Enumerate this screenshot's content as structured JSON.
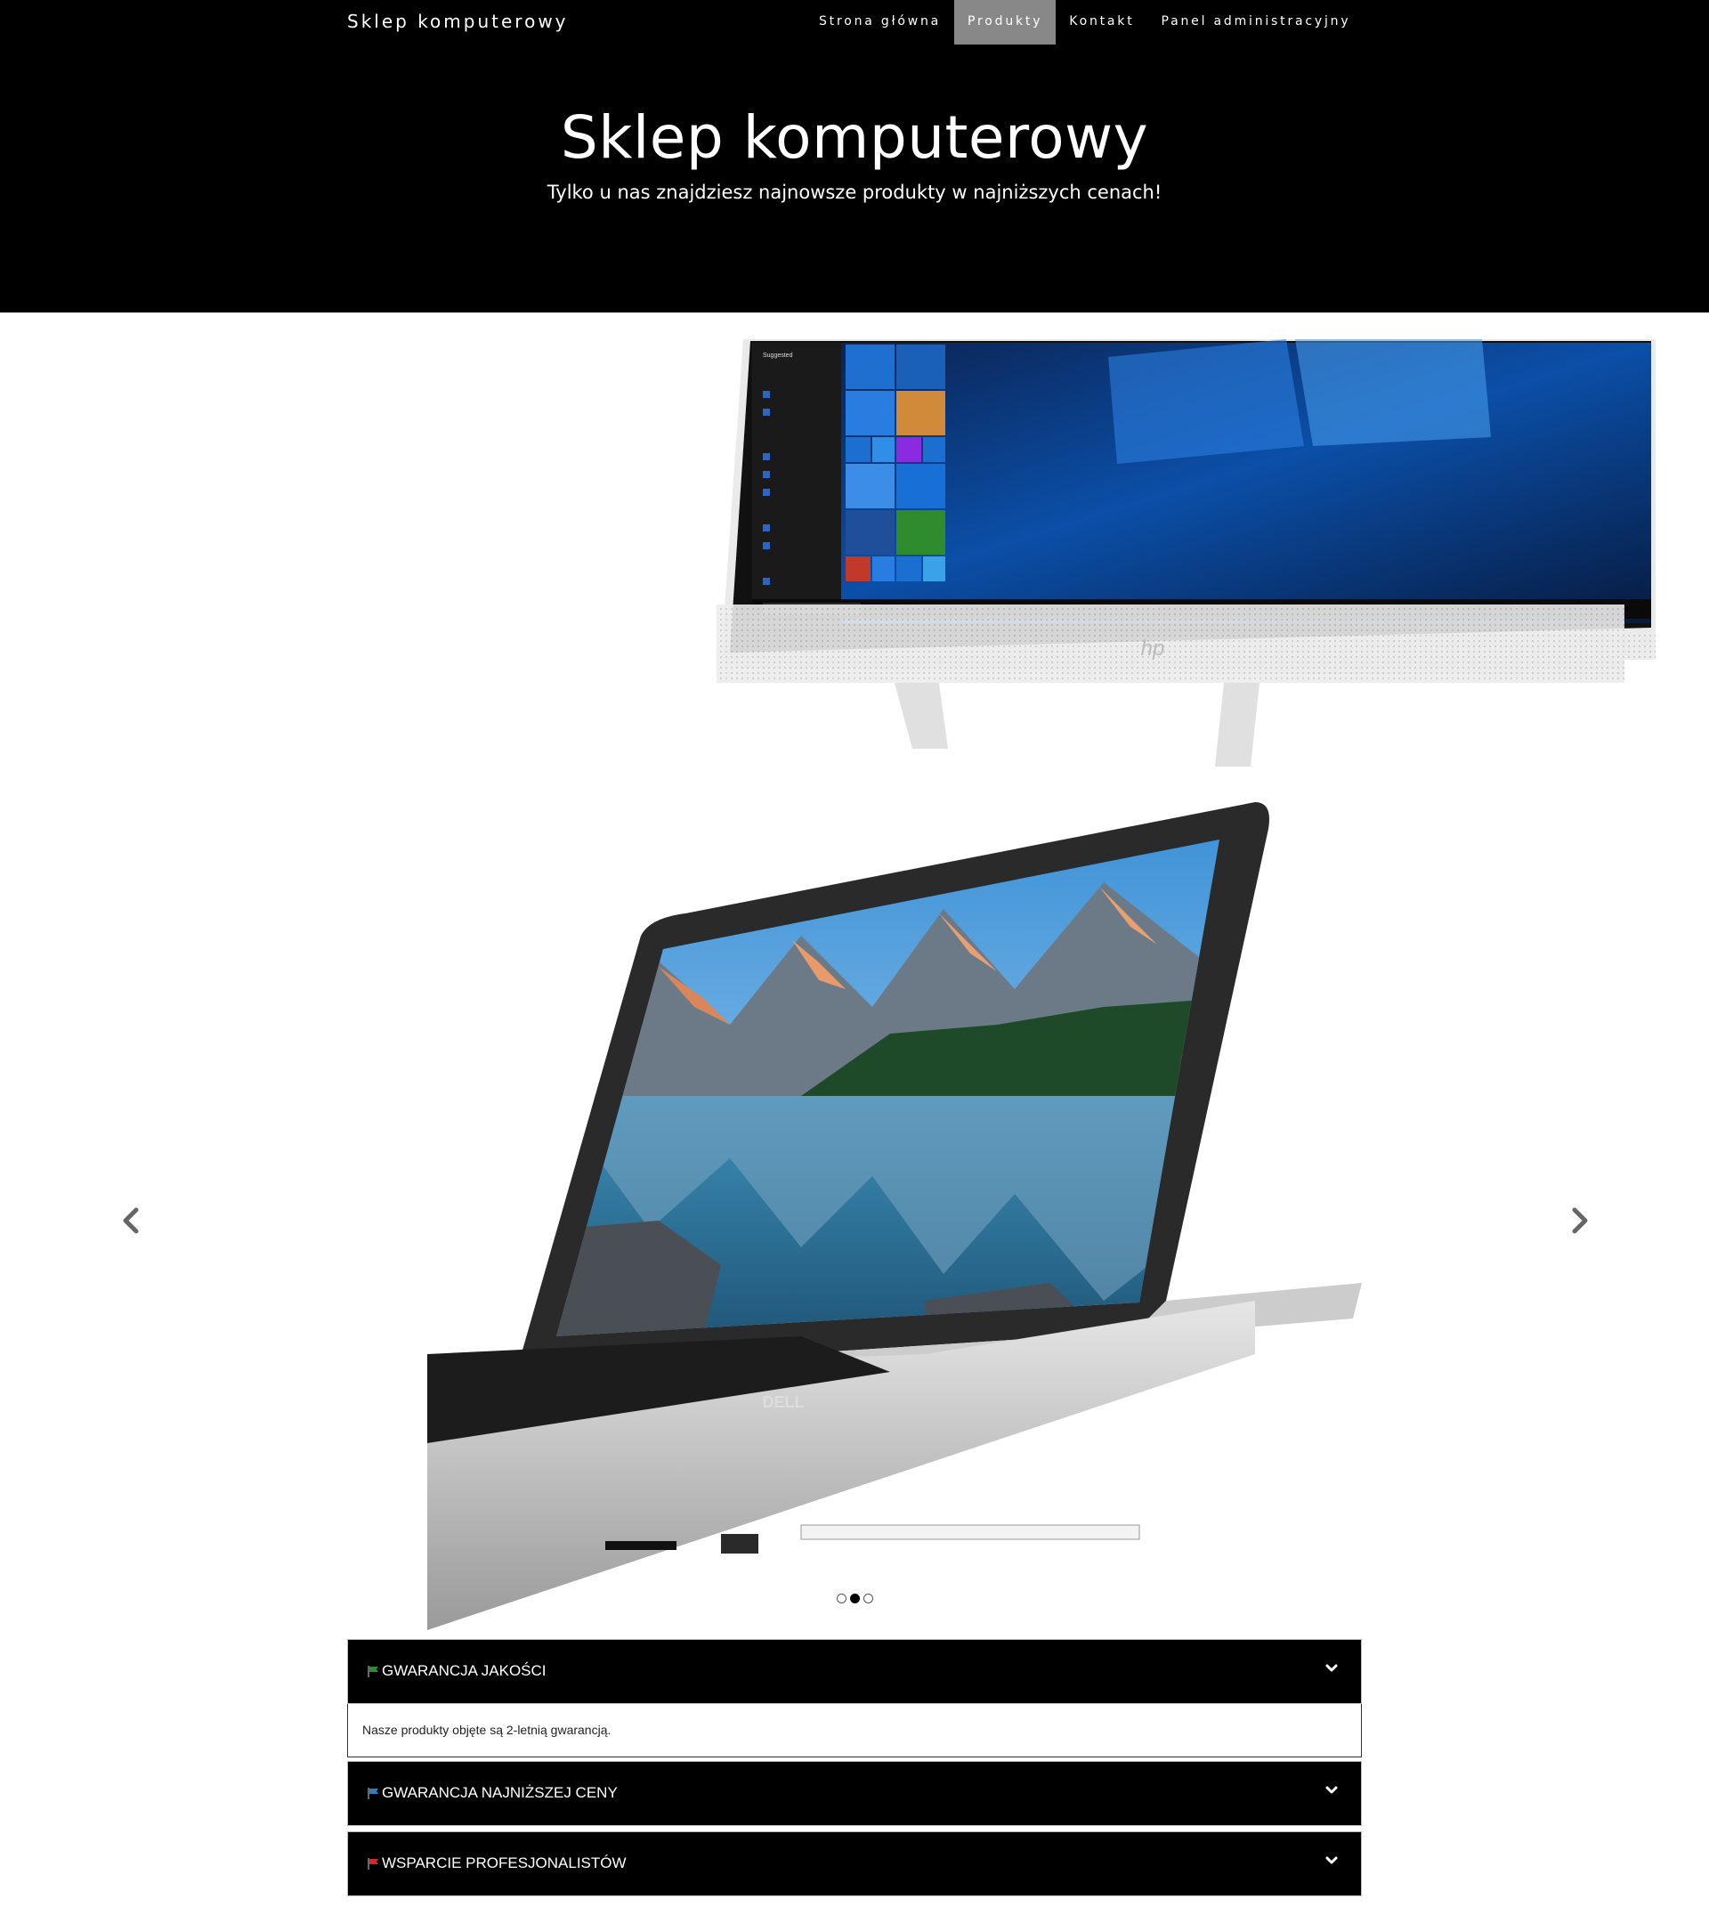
{
  "nav": {
    "brand": "Sklep komputerowy",
    "items": [
      {
        "label": "Strona główna"
      },
      {
        "label": "Produkty"
      },
      {
        "label": "Kontakt"
      },
      {
        "label": "Panel administracyjny"
      }
    ]
  },
  "hero": {
    "title": "Sklep komputerowy",
    "subtitle": "Tylko u nas znajdziesz najnowsze produkty w najniższych cenach!"
  },
  "carousel": {
    "slides": [
      {
        "image": "hp-all-in-one-monitor",
        "screen_text": "Suggested",
        "brand_logo": "hp"
      },
      {
        "image": "dell-laptop-lake-mountains",
        "brand_logo": "DELL"
      }
    ],
    "dots": 3,
    "active_dot": 2,
    "prev_icon": "chevron-left-icon",
    "next_icon": "chevron-right-icon"
  },
  "accordion": [
    {
      "title": "GWARANCJA JAKOŚCI",
      "flag_color": "#2e8b2e",
      "body": "Nasze produkty objęte są 2-letnią gwarancją.",
      "open": true
    },
    {
      "title": "GWARANCJA NAJNIŻSZEJ CENY",
      "flag_color": "#2f7fc0",
      "open": false
    },
    {
      "title": "WSPARCIE PROFESJONALISTÓW",
      "flag_color": "#d22a2a",
      "open": false
    }
  ],
  "colors": {
    "nav_bg": "#000000",
    "active_tab": "#888888",
    "accordion_bg": "#000000"
  }
}
